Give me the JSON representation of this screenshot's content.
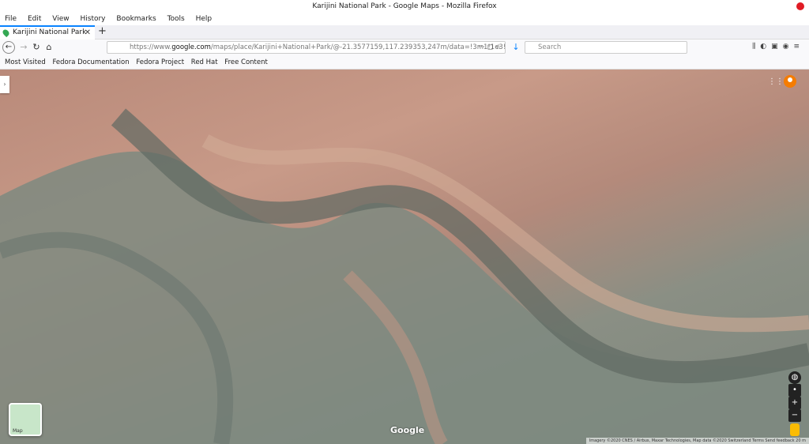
{
  "window": {
    "title": "Karijini National Park - Google Maps - Mozilla Firefox"
  },
  "menu": [
    "File",
    "Edit",
    "View",
    "History",
    "Bookmarks",
    "Tools",
    "Help"
  ],
  "tab": {
    "label": "Karijini National Park"
  },
  "urlbar": {
    "prefix": "https://www.",
    "host": "google.com",
    "rest": "/maps/place/Karijini+National+Park/@-21.3577159,117.239353,247m/data=!3m1!1e3!4"
  },
  "search": {
    "placeholder": "Search"
  },
  "bookmarks": [
    "Most Visited",
    "Fedora Documentation",
    "Fedora Project",
    "Red Hat",
    "Free Content"
  ],
  "map": {
    "thumb_label": "Map",
    "logo": "Google",
    "attribution": "Imagery ©2020 CNES / Airbus, Maxar Technologies, Map data ©2020   Switzerland   Terms   Send feedback   20 m"
  }
}
